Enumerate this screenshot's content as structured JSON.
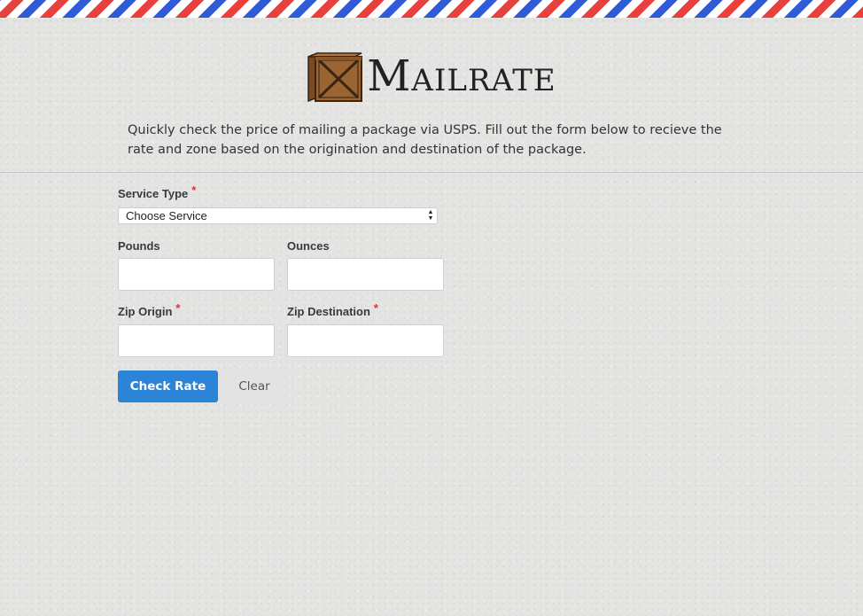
{
  "app": {
    "logo": {
      "big_letter": "M",
      "rest": "AILRATE"
    },
    "intro": "Quickly check the price of mailing a package via USPS. Fill out the form below to recieve the rate and zone based on the origination and destination of the package."
  },
  "form": {
    "service_type": {
      "label": "Service Type",
      "required_mark": "*",
      "selected": "Choose Service"
    },
    "pounds": {
      "label": "Pounds",
      "value": ""
    },
    "ounces": {
      "label": "Ounces",
      "value": ""
    },
    "zip_origin": {
      "label": "Zip Origin",
      "required_mark": "*",
      "value": ""
    },
    "zip_destination": {
      "label": "Zip Destination",
      "required_mark": "*",
      "value": ""
    },
    "check_rate_label": "Check Rate",
    "clear_label": "Clear"
  },
  "colors": {
    "accent": "#2c84d8",
    "required": "#e0322f",
    "stripe_red": "#e8413d",
    "stripe_blue": "#2f5bd8"
  },
  "icons": {
    "logo": "wooden-crate-icon",
    "select": "select-arrows-icon"
  }
}
